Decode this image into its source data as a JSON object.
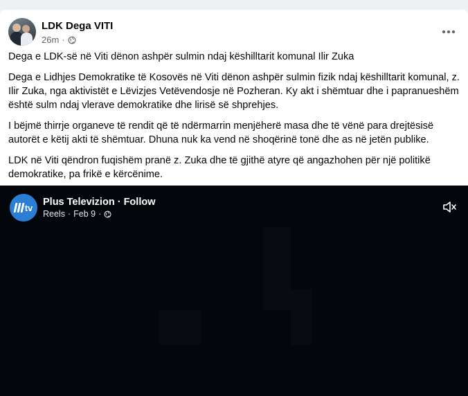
{
  "post": {
    "author": "LDK Dega VITI",
    "time": "26m",
    "separator": "·",
    "more_label": "•••",
    "paragraphs": [
      "Dega e LDK-së në Viti dënon ashpër sulmin ndaj këshilltarit komunal Ilir Zuka",
      "Dega e Lidhjes Demokratike të Kosovës në Viti dënon ashpër sulmin fizik ndaj këshilltarit komunal, z. Ilir Zuka, nga aktivistët e Lëvizjes Vetëvendosje në Pozheran. Ky akt i shëmtuar dhe i papranueshëm është sulm ndaj vlerave demokratike dhe lirisë së shprehjes.",
      "I bëjmë thirrje organeve të rendit që të ndërmarrin menjëherë masa dhe të vënë para drejtësisë autorët e këtij akti të shëmtuar. Dhuna nuk ka vend në shoqërinë tonë dhe as në jetën publike.",
      "LDK në Viti qëndron fuqishëm pranë z. Zuka dhe të gjithë atyre që angazhohen për një politikë demokratike, pa frikë e kërcënime."
    ]
  },
  "video": {
    "logo_text": "tv",
    "channel": "Plus Televizion",
    "dot": " · ",
    "follow_label": "Follow",
    "source": "Reels",
    "date": "Feb 9",
    "separator": "·"
  },
  "icons": {
    "globe": "globe-icon",
    "more": "more-options-icon",
    "mute": "muted-speaker-icon"
  },
  "colors": {
    "card_bg": "#ffffff",
    "page_bg": "#f0f2f5",
    "text_primary": "#050505",
    "text_secondary": "#65676b",
    "video_bg": "#03060b",
    "logo_blue": "#2a7fd4"
  }
}
